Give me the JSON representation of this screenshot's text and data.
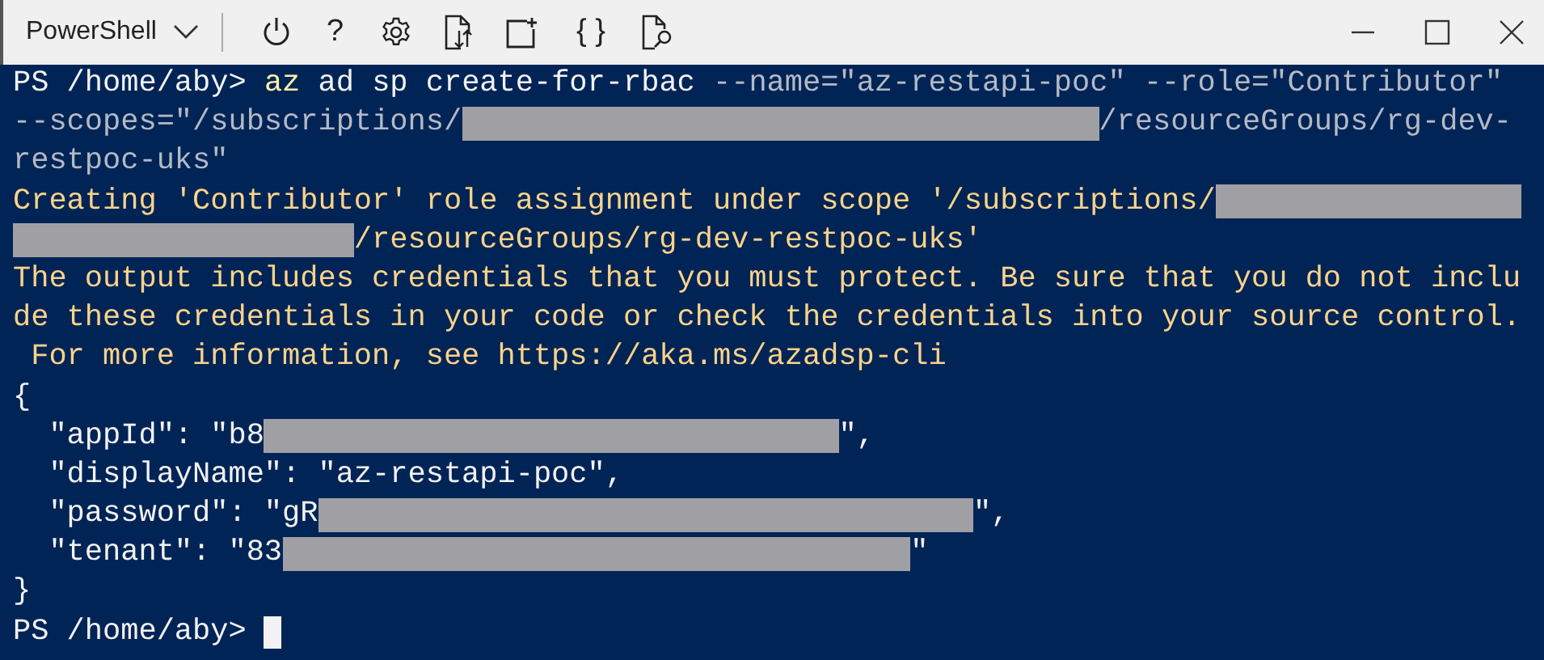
{
  "titlebar": {
    "shell_selector": "PowerShell",
    "toolbar": [
      {
        "kind": "power"
      },
      {
        "kind": "glyph",
        "text": "?"
      },
      {
        "kind": "gear"
      },
      {
        "kind": "transfer"
      },
      {
        "kind": "new-tab"
      },
      {
        "kind": "glyph",
        "text": "{ }"
      },
      {
        "kind": "web-preview"
      }
    ]
  },
  "terminal": {
    "lines": [
      {
        "segments": [
          {
            "kind": "prompt",
            "text": "PS /home/aby> "
          },
          {
            "kind": "command",
            "text": "az"
          },
          {
            "kind": "arg",
            "text": " ad sp create-for-rbac "
          },
          {
            "kind": "param",
            "text": "--name=\"az-restapi-poc\" --role=\"Contributor\""
          }
        ]
      },
      {
        "segments": [
          {
            "kind": "param",
            "text": "--scopes=\"/subscriptions/"
          },
          {
            "kind": "redacted"
          },
          {
            "kind": "param",
            "text": "/resourceGroups/rg-dev-"
          }
        ]
      },
      {
        "segments": [
          {
            "kind": "param",
            "text": "restpoc-uks\""
          }
        ]
      },
      {
        "segments": [
          {
            "kind": "warning",
            "text": "Creating 'Contributor' role assignment under scope '/subscriptions/"
          },
          {
            "kind": "redacted"
          }
        ]
      },
      {
        "segments": [
          {
            "kind": "redacted"
          },
          {
            "kind": "warning",
            "text": "/resourceGroups/rg-dev-restpoc-uks'"
          }
        ]
      },
      {
        "segments": [
          {
            "kind": "warning",
            "text": "The output includes credentials that you must protect. Be sure that you do not inclu"
          }
        ]
      },
      {
        "segments": [
          {
            "kind": "warning",
            "text": "de these credentials in your code or check the credentials into your source control."
          }
        ]
      },
      {
        "segments": [
          {
            "kind": "warning",
            "text": " For more information, see https://aka.ms/azadsp-cli"
          }
        ]
      },
      {
        "segments": [
          {
            "kind": "output",
            "text": "{"
          }
        ]
      },
      {
        "segments": [
          {
            "kind": "output",
            "text": "  \"appId\": \"b8"
          },
          {
            "kind": "redacted"
          },
          {
            "kind": "output",
            "text": "\","
          }
        ]
      },
      {
        "segments": [
          {
            "kind": "output",
            "text": "  \"displayName\": \"az-restapi-poc\","
          }
        ]
      },
      {
        "segments": [
          {
            "kind": "output",
            "text": "  \"password\": \"gR"
          },
          {
            "kind": "redacted"
          },
          {
            "kind": "output",
            "text": "\","
          }
        ]
      },
      {
        "segments": [
          {
            "kind": "output",
            "text": "  \"tenant\": \"83"
          },
          {
            "kind": "redacted"
          },
          {
            "kind": "output",
            "text": "\""
          }
        ]
      },
      {
        "segments": [
          {
            "kind": "output",
            "text": "}"
          }
        ]
      },
      {
        "segments": [
          {
            "kind": "prompt",
            "text": "PS /home/aby> "
          },
          {
            "kind": "cursor"
          }
        ]
      }
    ]
  }
}
